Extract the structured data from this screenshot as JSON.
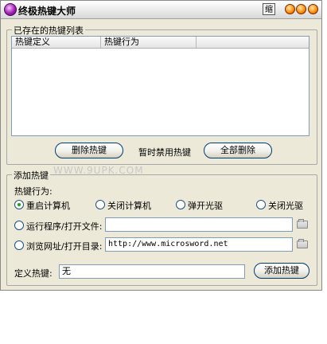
{
  "window": {
    "title": "终极热键大师",
    "mini_button": "缩"
  },
  "existing_group": {
    "label": "已存在的热键列表",
    "columns": [
      "热键定义",
      "热键行为"
    ],
    "delete_button": "删除热键",
    "disable_label": "暂时禁用热键",
    "delete_all_button": "全部删除"
  },
  "watermark": "WWW.9UPK.COM",
  "add_group": {
    "label": "添加热键",
    "action_label": "热键行为:",
    "radios": [
      "重启计算机",
      "关闭计算机",
      "弹开光驱",
      "关闭光驱"
    ],
    "run_program_label": "运行程序/打开文件:",
    "run_program_value": "",
    "browse_label": "浏览网址/打开目录:",
    "browse_value": "http://www.microsword.net",
    "define_label": "定义热键:",
    "define_value": "无",
    "add_button": "添加热键"
  }
}
